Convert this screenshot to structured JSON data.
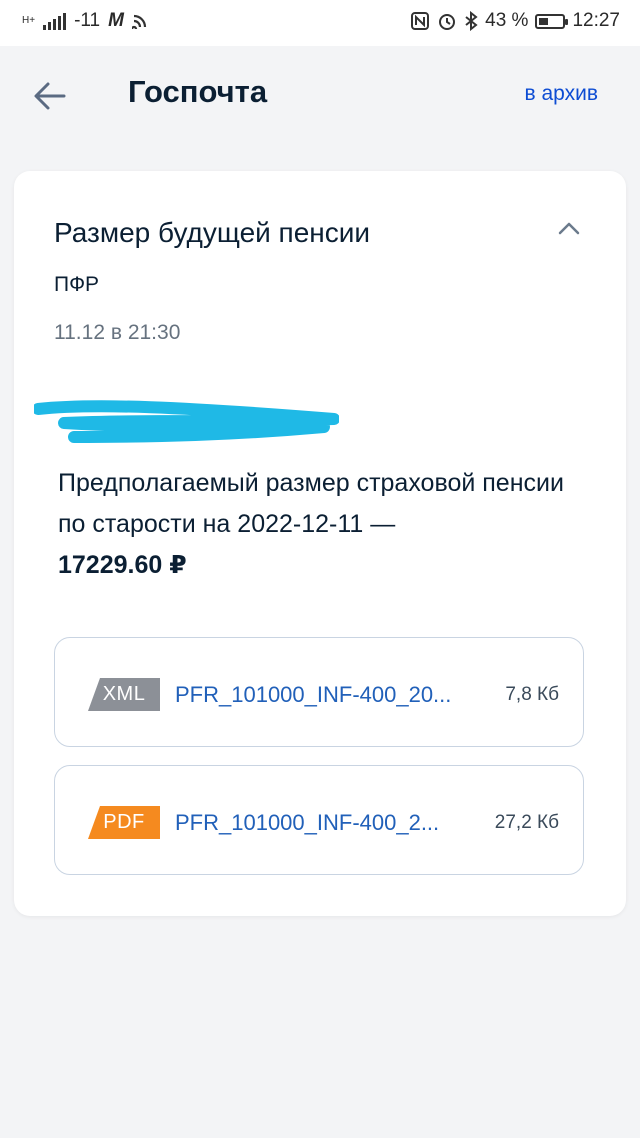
{
  "status_bar": {
    "network": "H+",
    "signal_value": "-11",
    "battery_percent": "43 %",
    "battery_level": 0.43,
    "time": "12:27",
    "icons": [
      "signal-icon",
      "m-app-icon",
      "wifi-icon",
      "nfc-icon",
      "alarm-icon",
      "bluetooth-icon",
      "battery-icon"
    ]
  },
  "header": {
    "title": "Госпочта",
    "archive_label": "в архив",
    "back_icon": "arrow-left-icon"
  },
  "message": {
    "title": "Размер будущей пенсии",
    "sender": "ПФР",
    "date": "11.12 в 21:30",
    "body_text": "Предполагаемый размер страховой пенсии по старости на 2022-12-11 —",
    "amount": "17229.60 ₽",
    "collapse_icon": "chevron-up-icon"
  },
  "attachments": [
    {
      "type": "XML",
      "badge_color": "#8c9097",
      "name": "PFR_101000_INF-400_20...",
      "size": "7,8 Кб"
    },
    {
      "type": "PDF",
      "badge_color": "#f58a1f",
      "name": "PFR_101000_INF-400_2...",
      "size": "27,2 Кб"
    }
  ],
  "colors": {
    "accent": "#0d4cd3",
    "link": "#2160b9",
    "redaction": "#1fb9e6"
  }
}
